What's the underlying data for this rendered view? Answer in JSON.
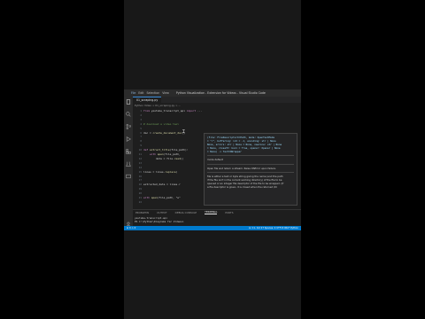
{
  "window": {
    "menus": [
      "File",
      "Edit",
      "Selection",
      "View",
      "Go",
      "Run",
      "Terminal",
      "Help"
    ],
    "title": "Python Visualization - Extension for Videos - Visual Studio Code"
  },
  "tabs": [
    {
      "label": "01_scraping.py"
    }
  ],
  "breadcrumb": "Python Video > 01_scraping.py > ...",
  "editor": {
    "lines": [
      {
        "num": "1",
        "text": "from youtube_transcript_api import ..."
      },
      {
        "num": "2",
        "text": ""
      },
      {
        "num": "3",
        "text": ""
      },
      {
        "num": "4",
        "text": "# download a video tool"
      },
      {
        "num": "5",
        "text": ""
      },
      {
        "num": "6",
        "text": "doc = create_document_doc()"
      },
      {
        "num": "7",
        "text": ""
      },
      {
        "num": "8",
        "text": ""
      },
      {
        "num": "9",
        "text": ""
      },
      {
        "num": "10",
        "text": "def extract_title(file_path):"
      },
      {
        "num": "11",
        "text": "    with open(file_path,"
      },
      {
        "num": "12",
        "text": "        data = file.read()"
      },
      {
        "num": "13",
        "text": ""
      },
      {
        "num": "14",
        "text": ""
      },
      {
        "num": "15",
        "text": "lines = lines.replace("
      },
      {
        "num": "16",
        "text": ""
      },
      {
        "num": "17",
        "text": ""
      },
      {
        "num": "18",
        "text": "extracted_data = lines.r"
      },
      {
        "num": "19",
        "text": ""
      },
      {
        "num": "20",
        "text": ""
      },
      {
        "num": "21",
        "text": "with open(file_path, \"w\""
      },
      {
        "num": "22",
        "text": ""
      }
    ]
  },
  "hover": {
    "signature": [
      "(file: FileDescriptorOrPath, mode: OpenTextMode",
      "= \"r\", buffering: int = -1, encoding: str | None",
      "None, errors: str | None = None, newline: str | None",
      "= None, closefd: bool = True, opener: Opener | None",
      "= None) -> TextIOWrapper"
    ],
    "doc": [
      "mode default",
      "Open file and return a stream. Raise OSError upon failure.",
      "file is either a text or byte string giving the name (and the path",
      "if the file isn't in the current working directory) of the file to be",
      "opened or an integer file descriptor of the file to be wrapped. (If",
      "a file descriptor is given, it is closed when the returned I/O"
    ]
  },
  "panel": {
    "tabs": [
      "PROBLEMS",
      "OUTPUT",
      "DEBUG CONSOLE",
      "TERMINAL",
      "PORTS"
    ],
    "active_tab": "TERMINAL",
    "terminal_lines": [
      "youtube-transcript-api",
      "PS C:\\Python\\Diagrams for Videos>"
    ]
  },
  "statusbar": {
    "left": "⊗ 0 ⚠ 0",
    "right": "Ln 11, Col 27   Spaces: 4   UTF-8   CRLF   Python"
  },
  "colors": {
    "accent": "#007acc",
    "editor_bg": "#1e1e1e",
    "hover_bg": "#252526"
  }
}
